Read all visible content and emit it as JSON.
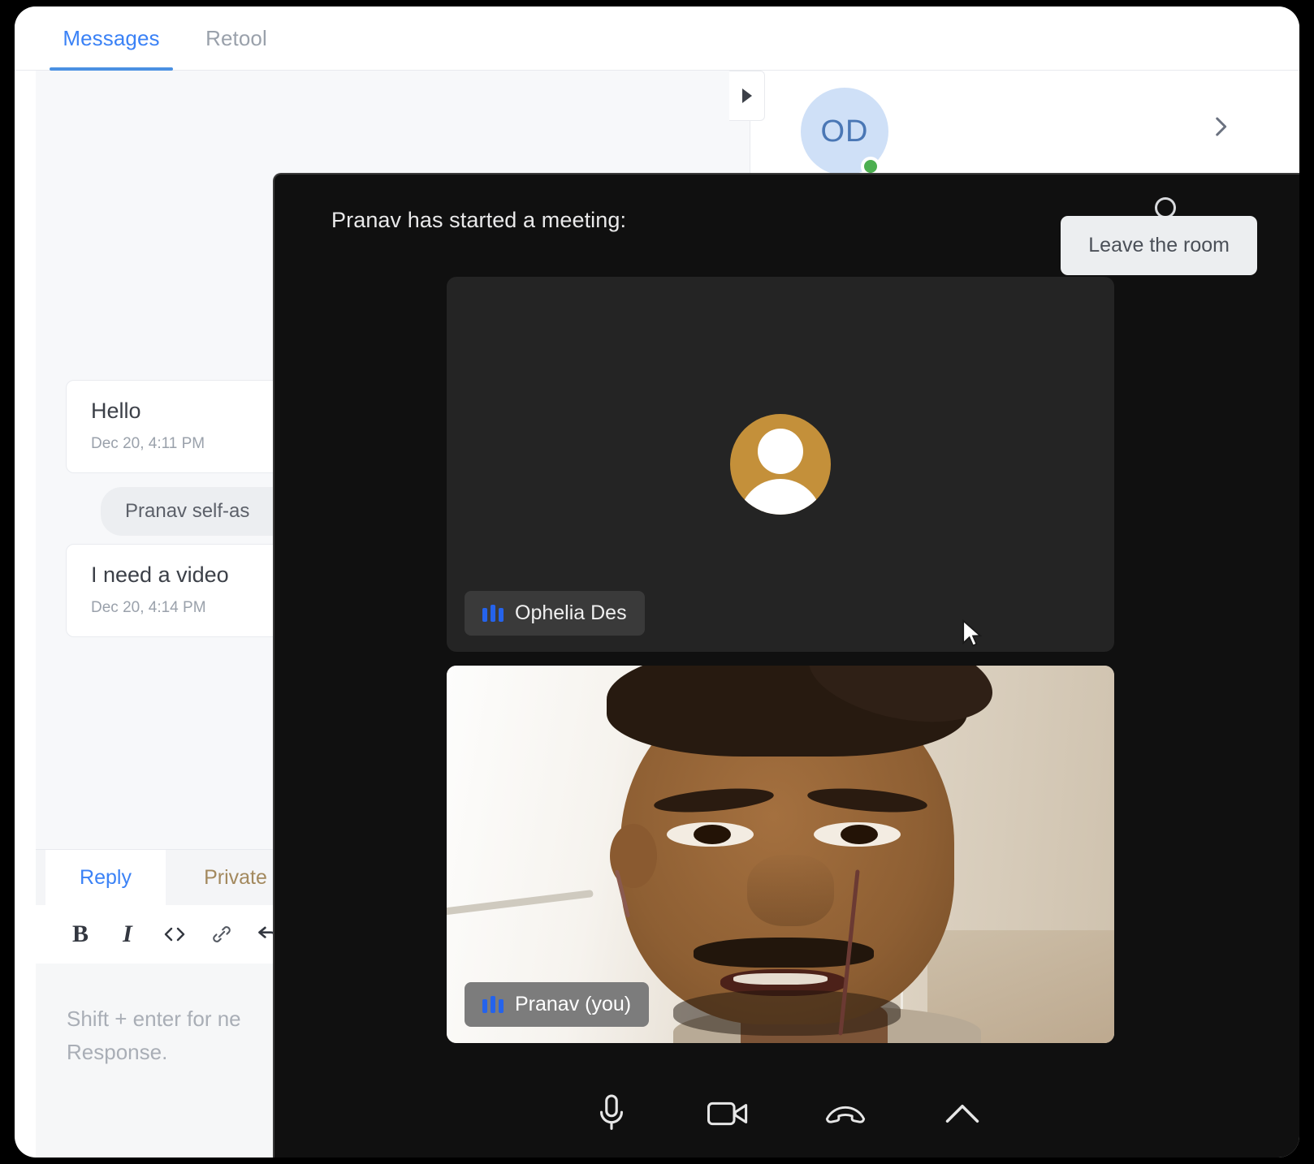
{
  "tabs": {
    "messages": "Messages",
    "retool": "Retool"
  },
  "conversation": {
    "messages": [
      {
        "title": "Hello",
        "time": "Dec 20, 4:11 PM"
      },
      {
        "title": "I need a video",
        "time": "Dec 20, 4:14 PM"
      }
    ],
    "system_note": "Pranav self-as",
    "kebab_icon": "kebab-menu-icon"
  },
  "contact": {
    "initials": "OD",
    "presence": "online",
    "chevron_icon": "chevron-right-icon",
    "expand_icon": "play-triangle-icon"
  },
  "composer": {
    "tabs": {
      "reply": "Reply",
      "private": "Private"
    },
    "format_buttons": [
      {
        "name": "bold-button",
        "label": "B"
      },
      {
        "name": "italic-button",
        "label": "I"
      },
      {
        "name": "code-button",
        "label": "<>"
      },
      {
        "name": "link-button",
        "label": "link-icon"
      },
      {
        "name": "undo-button",
        "label": "undo-icon"
      }
    ],
    "placeholder_line1": "Shift + enter for ne",
    "placeholder_line2": "Response."
  },
  "meeting": {
    "title": "Pranav has started a meeting:",
    "leave_button": "Leave the room",
    "participants": [
      {
        "name": "Ophelia Des",
        "video_on": false,
        "audio_icon": "audio-level-icon"
      },
      {
        "name": "Pranav (you)",
        "video_on": true,
        "audio_icon": "audio-level-icon"
      }
    ],
    "controls": [
      {
        "name": "microphone-button",
        "icon": "microphone-icon"
      },
      {
        "name": "camera-button",
        "icon": "video-camera-icon"
      },
      {
        "name": "hangup-button",
        "icon": "phone-hangup-icon"
      },
      {
        "name": "more-options-button",
        "icon": "chevron-up-icon"
      }
    ]
  },
  "colors": {
    "accent_blue": "#3b82f6",
    "private_tab": "#a3895e",
    "avatar_bg": "#cfe0f7",
    "avatar_text": "#4a77b5",
    "presence_green": "#4caf50",
    "meeting_bg": "#101010",
    "tile_bg": "#242424",
    "audio_bar_blue": "#2563eb",
    "placeholder_avatar": "#c4903a"
  }
}
